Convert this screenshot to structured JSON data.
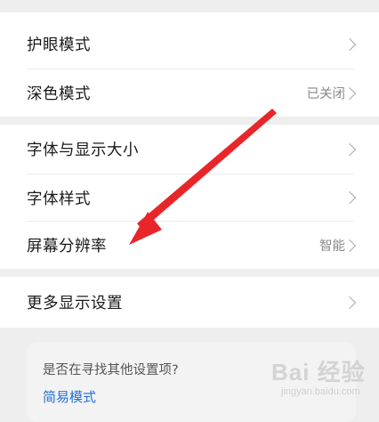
{
  "groups": [
    {
      "items": [
        {
          "label": "护眼模式",
          "value": ""
        },
        {
          "label": "深色模式",
          "value": "已关闭"
        }
      ]
    },
    {
      "items": [
        {
          "label": "字体与显示大小",
          "value": ""
        },
        {
          "label": "字体样式",
          "value": ""
        },
        {
          "label": "屏幕分辨率",
          "value": "智能"
        }
      ]
    },
    {
      "items": [
        {
          "label": "更多显示设置",
          "value": ""
        }
      ]
    }
  ],
  "tip": {
    "question": "是否在寻找其他设置项?",
    "link": "简易模式"
  },
  "watermark": {
    "main": "Bai 经验",
    "sub": "jingyan.baidu.com"
  },
  "colors": {
    "background": "#eeeeee",
    "card": "#ffffff",
    "link": "#1e6fd8",
    "annotation_arrow": "#e8262a"
  }
}
